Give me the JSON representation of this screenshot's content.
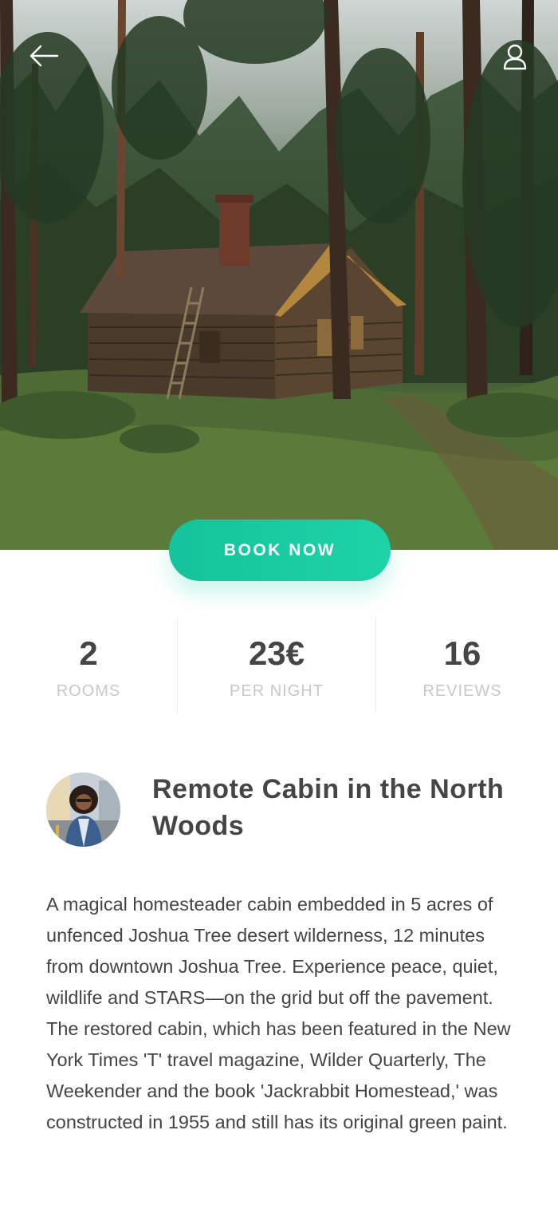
{
  "hero": {
    "image_alt": "Wooden log cabin in a pine forest"
  },
  "nav": {
    "back_icon": "arrow-left-icon",
    "profile_icon": "user-icon"
  },
  "booking": {
    "button_label": "BOOK NOW",
    "accent_color": "#1ec9a1"
  },
  "stats": [
    {
      "value": "2",
      "label": "ROOMS"
    },
    {
      "value": "23€",
      "label": "PER NIGHT"
    },
    {
      "value": "16",
      "label": "REVIEWS"
    }
  ],
  "listing": {
    "title": "Remote Cabin in the North Woods",
    "host_avatar": "host-avatar",
    "description": "A magical homesteader cabin embedded in 5 acres of unfenced Joshua Tree desert wilderness, 12 minutes from downtown Joshua Tree. Experience peace, quiet, wildlife and STARS—on the grid but off the pavement. The restored cabin, which has been featured in the New York Times 'T' travel magazine, Wilder Quarterly, The Weekender and the book 'Jackrabbit Homestead,' was constructed in 1955 and still has its original green paint."
  }
}
